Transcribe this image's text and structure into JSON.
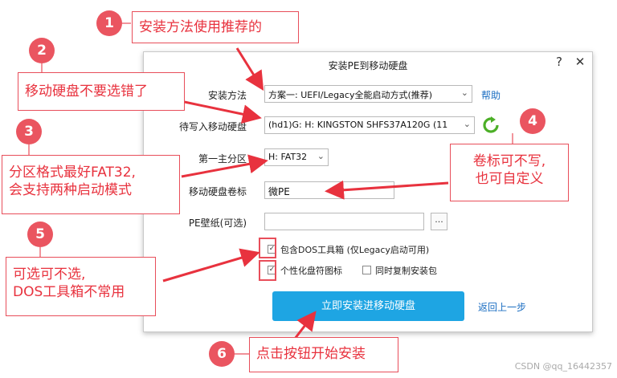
{
  "window": {
    "title": "安装PE到移动硬盘",
    "help_btn": "?",
    "close_btn": "✕"
  },
  "form": {
    "install_method_label": "安装方法",
    "install_method_value": "方案一: UEFI/Legacy全能启动方式(推荐)",
    "help_link": "帮助",
    "target_disk_label": "待写入移动硬盘",
    "target_disk_value": "(hd1)G: H: KINGSTON  SHFS37A120G (11",
    "partition_label": "第一主分区",
    "partition_value": "H: FAT32",
    "volume_label": "移动硬盘卷标",
    "volume_value": "微PE",
    "wallpaper_label": "PE壁纸(可选)",
    "wallpaper_value": "",
    "browse_btn": "...",
    "opt_dos_label": "包含DOS工具箱 (仅Legacy启动可用)",
    "opt_icon_label": "个性化盘符图标",
    "opt_copy_label": "同时复制安装包",
    "install_btn": "立即安装进移动硬盘",
    "back_link": "返回上一步"
  },
  "callouts": [
    {
      "num": "1",
      "text": "安装方法使用推荐的"
    },
    {
      "num": "2",
      "text": "移动硬盘不要选错了"
    },
    {
      "num": "3",
      "line1": "分区格式最好FAT32,",
      "line2": "会支持两种启动模式"
    },
    {
      "num": "4",
      "line1": "卷标可不写,",
      "line2": "也可自定义"
    },
    {
      "num": "5",
      "line1": "可选可不选,",
      "line2": "DOS工具箱不常用"
    },
    {
      "num": "6",
      "text": "点击按钮开始安装"
    }
  ],
  "watermark": "CSDN @qq_16442357",
  "colors": {
    "accent": "#ea5560",
    "button": "#1ea5e3",
    "link": "#1b6ec2"
  }
}
